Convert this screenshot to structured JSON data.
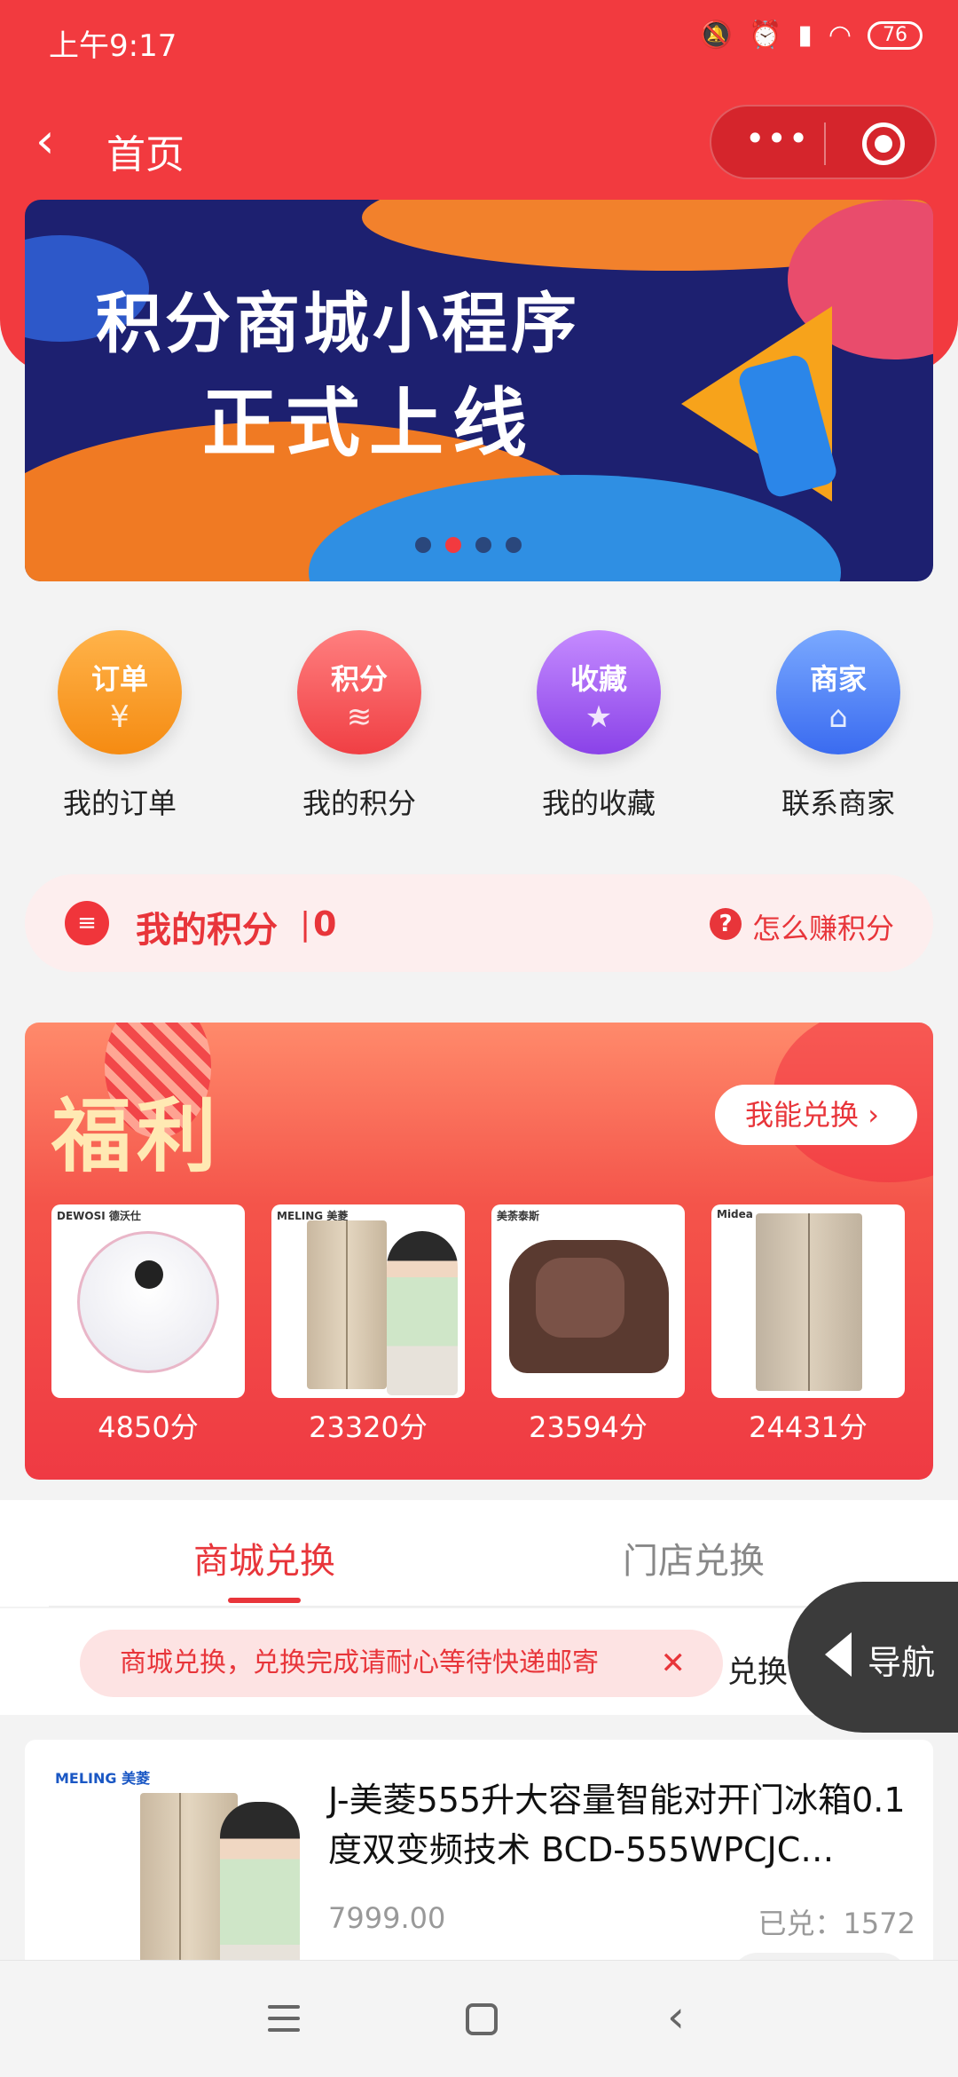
{
  "status_bar": {
    "time": "上午9:17",
    "icons": [
      "bell-muted-icon",
      "alarm-icon",
      "hd-signal-icon",
      "wifi-icon"
    ],
    "battery": "76"
  },
  "navbar": {
    "title": "首页",
    "back_icon": "chevron-left-icon",
    "more_icon": "more-dots-icon",
    "close_icon": "target-circle-icon"
  },
  "banner": {
    "title_line1": "积分商城小程序",
    "title_line2": "正式上线",
    "slide_count": 4,
    "active_slide": 2
  },
  "quick_actions": [
    {
      "icon_text": "订单",
      "label": "我的订单",
      "color": "#f58b12"
    },
    {
      "icon_text": "积分",
      "label": "我的积分",
      "color": "#f03f44"
    },
    {
      "icon_text": "收藏",
      "label": "我的收藏",
      "color": "#8a42e8"
    },
    {
      "icon_text": "商家",
      "label": "联系商家",
      "color": "#3a6bf0"
    }
  ],
  "points": {
    "label": "我的积分",
    "separator": "|",
    "value": "0",
    "help_label": "怎么赚积分"
  },
  "welfare": {
    "title": "福利",
    "button": "我能兑换",
    "products": [
      {
        "brand": "DEWOSI 德沃仕",
        "price": "4850分"
      },
      {
        "brand": "MELING 美菱",
        "price": "23320分"
      },
      {
        "brand": "美荼泰斯",
        "price": "23594分"
      },
      {
        "brand": "Midea",
        "price": "24431分"
      }
    ]
  },
  "tabs": {
    "items": [
      "商城兑换",
      "门店兑换"
    ],
    "active": 0
  },
  "filter": {
    "toast": "商城兑换，兑换完成请耐心等待快递邮寄",
    "close": "✕",
    "sort_label": "兑换"
  },
  "float_nav": {
    "label": "导航"
  },
  "list": [
    {
      "brand": "MELING 美菱",
      "title": "J-美菱555升大容量智能对开门冰箱0.1度双变频技术 BCD-555WPCJC…",
      "price": "7999.00",
      "sold": "已兑：1572"
    }
  ],
  "colors": {
    "primary": "#f23a3f",
    "accent_text": "#e8353a"
  }
}
